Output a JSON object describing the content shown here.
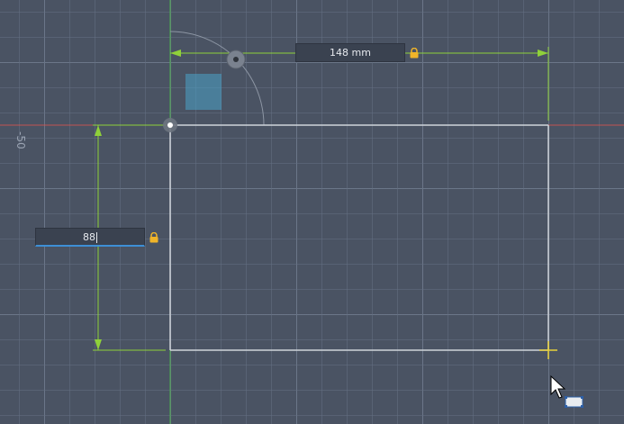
{
  "sketch": {
    "horizontal_dimension": {
      "value": "148 mm",
      "locked": true
    },
    "vertical_dimension": {
      "value": "88",
      "locked": true,
      "editing": true
    },
    "axis_ruler_label": "-50"
  },
  "colors": {
    "background": "#4a5363",
    "x_axis": "#d9534f",
    "y_axis": "#4caf50",
    "dimension_line": "#8fd13a",
    "sketch_line": "#d0d4da",
    "lock": "#f0b429",
    "input_focus": "#3d8fd6"
  },
  "icons": {
    "lock": "padlock-icon",
    "cursor": "arrow-cursor-icon",
    "origin": "origin-point-icon",
    "rotate_handle": "rotate-handle-icon"
  }
}
